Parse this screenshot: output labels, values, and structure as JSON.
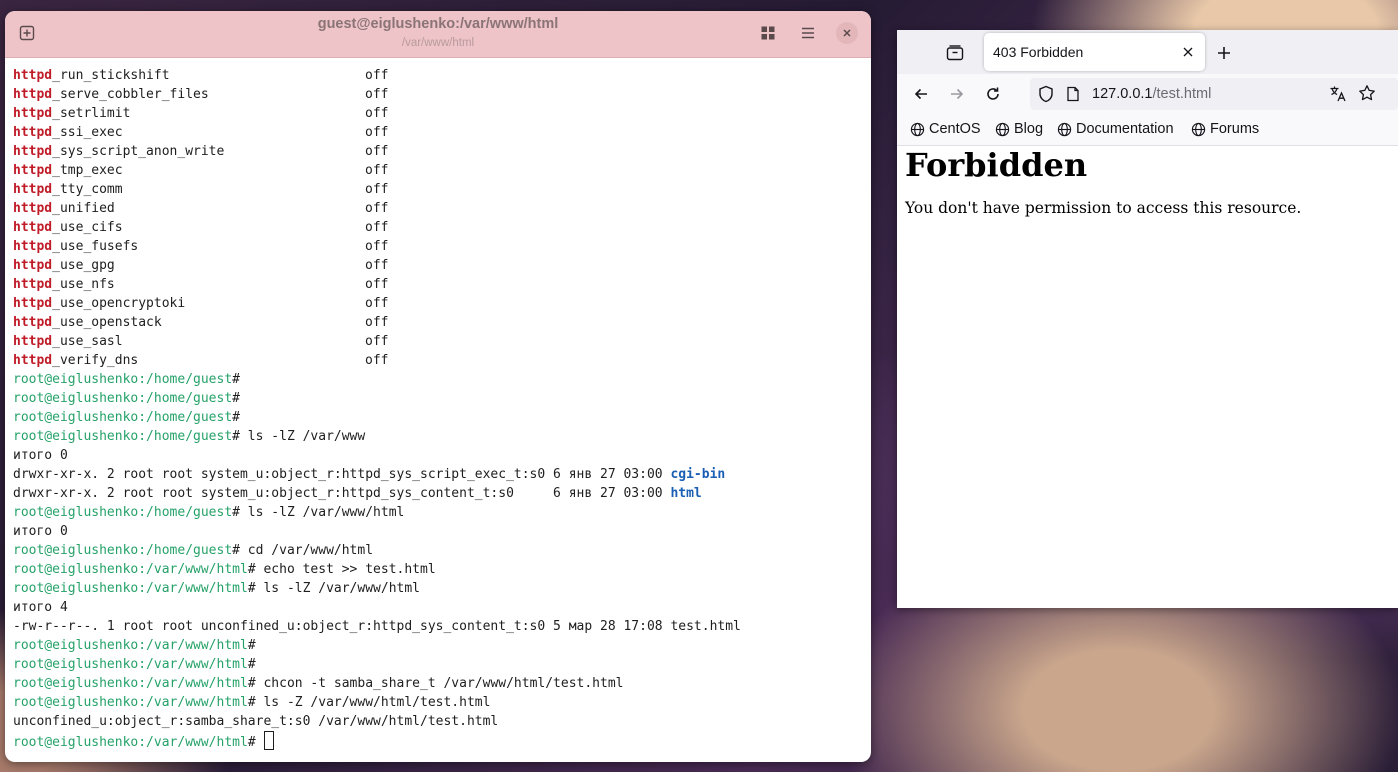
{
  "terminal": {
    "title": "guest@eiglushenko:/var/www/html",
    "subtitle": "/var/www/html",
    "prompt_user": "root@eiglushenko",
    "bool_prefix": "httpd",
    "booleans": [
      {
        "name": "_run_stickshift",
        "value": "off"
      },
      {
        "name": "_serve_cobbler_files",
        "value": "off"
      },
      {
        "name": "_setrlimit",
        "value": "off"
      },
      {
        "name": "_ssi_exec",
        "value": "off"
      },
      {
        "name": "_sys_script_anon_write",
        "value": "off"
      },
      {
        "name": "_tmp_exec",
        "value": "off"
      },
      {
        "name": "_tty_comm",
        "value": "off"
      },
      {
        "name": "_unified",
        "value": "off"
      },
      {
        "name": "_use_cifs",
        "value": "off"
      },
      {
        "name": "_use_fusefs",
        "value": "off"
      },
      {
        "name": "_use_gpg",
        "value": "off"
      },
      {
        "name": "_use_nfs",
        "value": "off"
      },
      {
        "name": "_use_opencryptoki",
        "value": "off"
      },
      {
        "name": "_use_openstack",
        "value": "off"
      },
      {
        "name": "_use_sasl",
        "value": "off"
      },
      {
        "name": "_verify_dns",
        "value": "off"
      }
    ],
    "lines": [
      {
        "kind": "prompt",
        "path": ":/home/guest",
        "cmd": "# "
      },
      {
        "kind": "prompt",
        "path": ":/home/guest",
        "cmd": "# "
      },
      {
        "kind": "prompt",
        "path": ":/home/guest",
        "cmd": "# "
      },
      {
        "kind": "prompt",
        "path": ":/home/guest",
        "cmd": "# ls -lZ /var/www"
      },
      {
        "kind": "out",
        "text": "итого 0"
      },
      {
        "kind": "dir",
        "text": "drwxr-xr-x. 2 root root system_u:object_r:httpd_sys_script_exec_t:s0 6 янв 27 03:00 ",
        "dir": "cgi-bin"
      },
      {
        "kind": "dir",
        "text": "drwxr-xr-x. 2 root root system_u:object_r:httpd_sys_content_t:s0     6 янв 27 03:00 ",
        "dir": "html"
      },
      {
        "kind": "prompt",
        "path": ":/home/guest",
        "cmd": "# ls -lZ /var/www/html"
      },
      {
        "kind": "out",
        "text": "итого 0"
      },
      {
        "kind": "prompt",
        "path": ":/home/guest",
        "cmd": "# cd /var/www/html"
      },
      {
        "kind": "prompt",
        "path": ":/var/www/html",
        "cmd": "# echo test >> test.html"
      },
      {
        "kind": "prompt",
        "path": ":/var/www/html",
        "cmd": "# ls -lZ /var/www/html"
      },
      {
        "kind": "out",
        "text": "итого 4"
      },
      {
        "kind": "out",
        "text": "-rw-r--r--. 1 root root unconfined_u:object_r:httpd_sys_content_t:s0 5 мар 28 17:08 test.html"
      },
      {
        "kind": "prompt",
        "path": ":/var/www/html",
        "cmd": "# "
      },
      {
        "kind": "prompt",
        "path": ":/var/www/html",
        "cmd": "# "
      },
      {
        "kind": "prompt",
        "path": ":/var/www/html",
        "cmd": "# chcon -t samba_share_t /var/www/html/test.html"
      },
      {
        "kind": "prompt",
        "path": ":/var/www/html",
        "cmd": "# ls -Z /var/www/html/test.html"
      },
      {
        "kind": "out",
        "text": "unconfined_u:object_r:samba_share_t:s0 /var/www/html/test.html"
      }
    ],
    "last_prompt": {
      "path": ":/var/www/html",
      "cmd": "# "
    }
  },
  "browser": {
    "tab_title": "403 Forbidden",
    "url_host": "127.0.0.1",
    "url_path": "/test.html",
    "bookmarks": [
      "CentOS",
      "Blog",
      "Documentation",
      "Forums"
    ],
    "heading": "Forbidden",
    "message": "You don't have permission to access this resource."
  }
}
